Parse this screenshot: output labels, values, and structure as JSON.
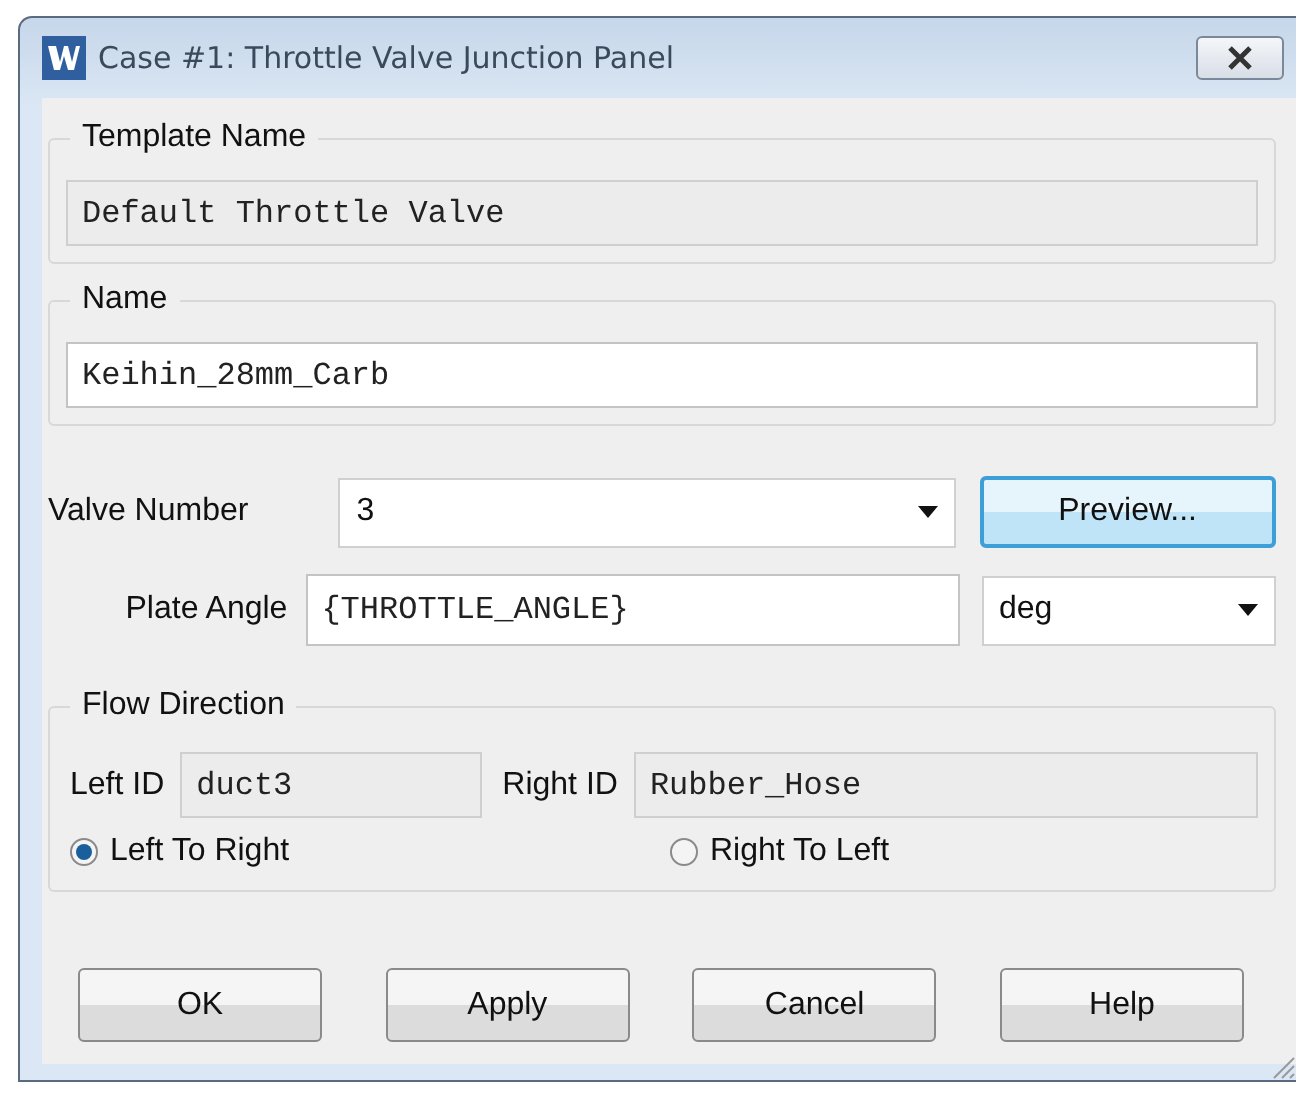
{
  "window": {
    "title": "Case #1: Throttle Valve Junction Panel"
  },
  "template_group": {
    "label": "Template Name",
    "field": {
      "value": "Default Throttle Valve",
      "readonly": true
    }
  },
  "name_group": {
    "label": "Name",
    "field": {
      "value": "Keihin_28mm_Carb",
      "readonly": false
    }
  },
  "valve_number": {
    "label": "Valve Number",
    "value": "3",
    "button": {
      "label": "Preview...",
      "focused": true
    }
  },
  "plate_angle": {
    "label": "Plate Angle",
    "value": "{THROTTLE_ANGLE}",
    "unit": "deg"
  },
  "flow_direction": {
    "label": "Flow Direction",
    "ids": [
      {
        "label": "Left ID",
        "value": "duct3",
        "readonly": true
      },
      {
        "label": "Right ID",
        "value": "Rubber_Hose",
        "readonly": true
      }
    ],
    "options": [
      {
        "label": "Left To Right",
        "selected": true
      },
      {
        "label": "Right To Left",
        "selected": false
      }
    ]
  },
  "buttons": [
    {
      "label": "OK",
      "focused": false
    },
    {
      "label": "Apply",
      "focused": false
    },
    {
      "label": "Cancel",
      "focused": false
    },
    {
      "label": "Help",
      "focused": false
    }
  ]
}
